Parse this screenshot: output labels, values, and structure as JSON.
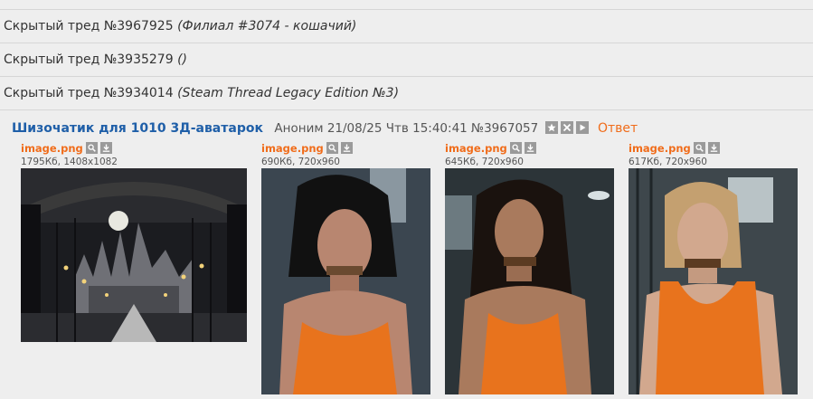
{
  "hidden_threads": [
    {
      "label": "Скрытый тред №3967925",
      "sub": "(Филиал #3074 - кошачий)"
    },
    {
      "label": "Скрытый тред №3935279",
      "sub": "()"
    },
    {
      "label": "Скрытый тред №3934014",
      "sub": "(Steam Thread Legacy Edition №3)"
    }
  ],
  "post": {
    "title": "Шизочатик для 1010 3Д-аватарок",
    "author": "Аноним",
    "datetime": "21/08/25 Чтв 15:40:41",
    "number": "№3967057",
    "reply_label": "Ответ",
    "files": [
      {
        "name": "image.png",
        "meta": "1795Кб, 1408x1082"
      },
      {
        "name": "image.png",
        "meta": "690Кб, 720x960"
      },
      {
        "name": "image.png",
        "meta": "645Кб, 720x960"
      },
      {
        "name": "image.png",
        "meta": "617Кб, 720x960"
      }
    ]
  },
  "colors": {
    "title": "#1f5fa8",
    "accent_orange": "#f06c1a",
    "button_gray": "#9a9a9a",
    "background": "#eeeeee"
  },
  "icons": [
    "search-icon",
    "download-icon",
    "star-icon",
    "close-icon",
    "play-icon"
  ]
}
